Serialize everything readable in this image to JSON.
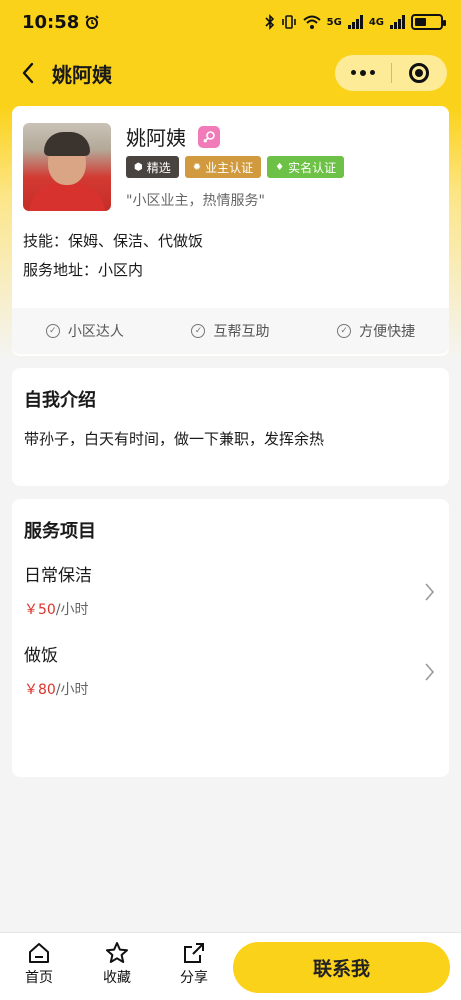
{
  "status_bar": {
    "time": "10:58",
    "network_1": "5G",
    "network_2": "4G"
  },
  "nav": {
    "title": "姚阿姨"
  },
  "profile": {
    "name": "姚阿姨",
    "badges": [
      "精选",
      "业主认证",
      "实名认证"
    ],
    "motto": "\"小区业主，热情服务\"",
    "skills": "技能：保姆、保洁、代做饭",
    "address": "服务地址：小区内",
    "features": [
      "小区达人",
      "互帮互助",
      "方便快捷"
    ]
  },
  "intro": {
    "title": "自我介绍",
    "text": "带孙子，白天有时间，做一下兼职，发挥余热"
  },
  "services": {
    "title": "服务项目",
    "items": [
      {
        "name": "日常保洁",
        "price": "￥50",
        "unit": "/小时"
      },
      {
        "name": "做饭",
        "price": "￥80",
        "unit": "/小时"
      }
    ]
  },
  "bottom_bar": {
    "home": "首页",
    "favorite": "收藏",
    "share": "分享",
    "contact": "联系我"
  },
  "colors": {
    "brand_yellow": "#fbd21a",
    "price_red": "#d9342b",
    "badge_dark": "#4a4440",
    "badge_gold": "#d19a3f",
    "badge_green": "#6dc146",
    "gender_pink": "#f07bb8"
  },
  "icons": {
    "status": [
      "alarm-icon",
      "bluetooth-icon",
      "vibrate-icon",
      "wifi-icon",
      "signal-icon",
      "battery-icon"
    ],
    "nav": [
      "back-icon",
      "more-icon",
      "close-target-icon"
    ],
    "tabs": [
      "home-icon",
      "star-icon",
      "share-icon"
    ]
  }
}
